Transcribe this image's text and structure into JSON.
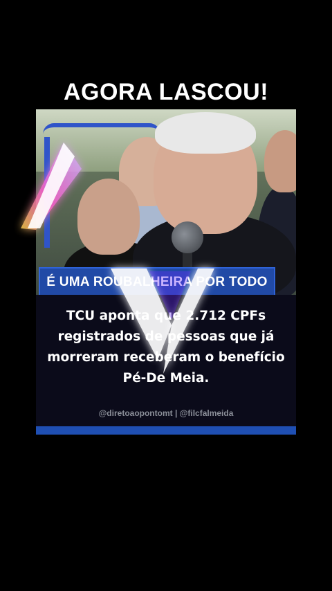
{
  "headline": "AGORA LASCOU!",
  "banner": "É UMA ROUBALHEIRA POR TODO LADO",
  "body_lines": [
    "TCU aponta que 2.712 CPFs",
    "registrados de pessoas que já",
    "morreram receberam o benefício",
    "Pé-De Meia."
  ],
  "credits": "@diretoaopontomt | @filcfalmeida",
  "colors": {
    "background": "#000000",
    "accent_blue": "#214aa6",
    "text": "#ffffff",
    "credits": "#8b8f99"
  },
  "icons": {
    "logo": "glowing-v-logo"
  }
}
